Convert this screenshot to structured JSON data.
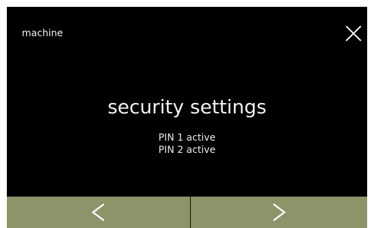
{
  "header": {
    "title": "machine",
    "close_icon": "close-icon"
  },
  "main": {
    "heading": "security settings",
    "status_lines": [
      "PIN 1 active",
      "PIN 2 active"
    ]
  },
  "footer": {
    "previous_icon": "chevron-left-icon",
    "next_icon": "chevron-right-icon"
  },
  "colors": {
    "screen_background": "#000000",
    "text": "#f2f2f2",
    "nav_button": "#8e936a"
  }
}
